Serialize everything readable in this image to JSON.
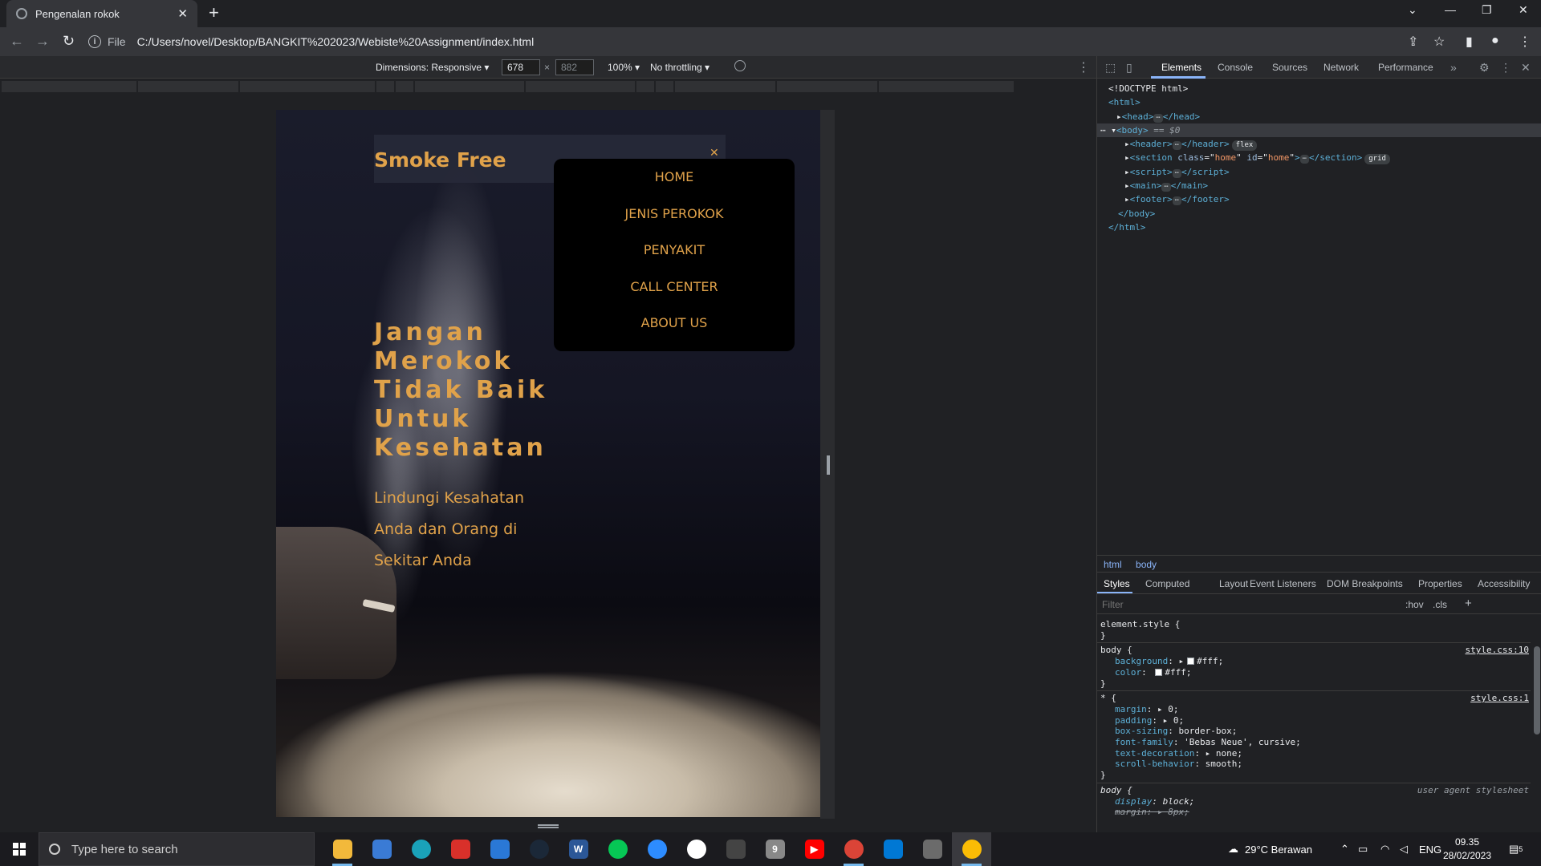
{
  "browser": {
    "tab_title": "Pengenalan rokok",
    "address_scheme": "File",
    "address_url": "C:/Users/novel/Desktop/BANGKIT%202023/Webiste%20Assignment/index.html"
  },
  "device_toolbar": {
    "dimensions_label": "Dimensions: Responsive",
    "width": "678",
    "height": "882",
    "zoom": "100%",
    "throttling": "No throttling"
  },
  "site": {
    "brand": "Smoke Free",
    "menu": [
      "HOME",
      "JENIS PEROKOK",
      "PENYAKIT",
      "CALL CENTER",
      "ABOUT US"
    ],
    "hero_title": "Jangan Merokok Tidak Baik Untuk Kesehatan",
    "hero_subtitle": "Lindungi Kesahatan Anda dan Orang di Sekitar Anda"
  },
  "devtools": {
    "tabs": [
      "Elements",
      "Console",
      "Sources",
      "Network",
      "Performance"
    ],
    "active_tab": "Elements",
    "dom": {
      "doctype": "<!DOCTYPE html>",
      "html_open": "<html>",
      "head": "head",
      "body": "body",
      "body_marker": "== $0",
      "header": "header",
      "header_badge": "flex",
      "section_tag": "section",
      "section_class": "home",
      "section_id": "home",
      "section_badge": "grid",
      "script": "script",
      "main": "main",
      "footer": "footer",
      "body_close": "</body>",
      "html_close": "</html>"
    },
    "breadcrumbs": [
      "html",
      "body"
    ],
    "styles_tabs": [
      "Styles",
      "Computed",
      "Layout",
      "Event Listeners",
      "DOM Breakpoints",
      "Properties",
      "Accessibility"
    ],
    "filter_placeholder": "Filter",
    "hov": ":hov",
    "cls": ".cls",
    "rules": {
      "element_style": "element.style {",
      "body_selector": "body {",
      "body_src": "style.css:10",
      "body_background_prop": "background",
      "body_background_val": "#fff;",
      "body_color_prop": "color",
      "body_color_val": "#fff;",
      "star_selector": "* {",
      "star_src": "style.css:1",
      "margin_prop": "margin",
      "margin_val": "0;",
      "padding_prop": "padding",
      "padding_val": "0;",
      "box_sizing_prop": "box-sizing",
      "box_sizing_val": "border-box;",
      "font_family_prop": "font-family",
      "font_family_val": "'Bebas Neue', cursive;",
      "text_decoration_prop": "text-decoration",
      "text_decoration_val": "none;",
      "scroll_behavior_prop": "scroll-behavior",
      "scroll_behavior_val": "smooth;",
      "ua_selector": "body {",
      "ua_src": "user agent stylesheet",
      "display_prop": "display",
      "display_val": "block;",
      "ua_margin_prop": "margin",
      "ua_margin_val": "8px;",
      "close_brace": "}"
    }
  },
  "taskbar": {
    "search_placeholder": "Type here to search",
    "weather": "29°C  Berawan",
    "language": "ENG",
    "time": "09.35",
    "date": "28/02/2023",
    "notification_count": "5",
    "apps": [
      "file-explorer",
      "store",
      "edge",
      "gift",
      "mail",
      "steam",
      "word",
      "line",
      "zoom",
      "app",
      "unity",
      "notepad",
      "youtube",
      "chrome-profile",
      "vscode",
      "game",
      "chrome"
    ]
  }
}
